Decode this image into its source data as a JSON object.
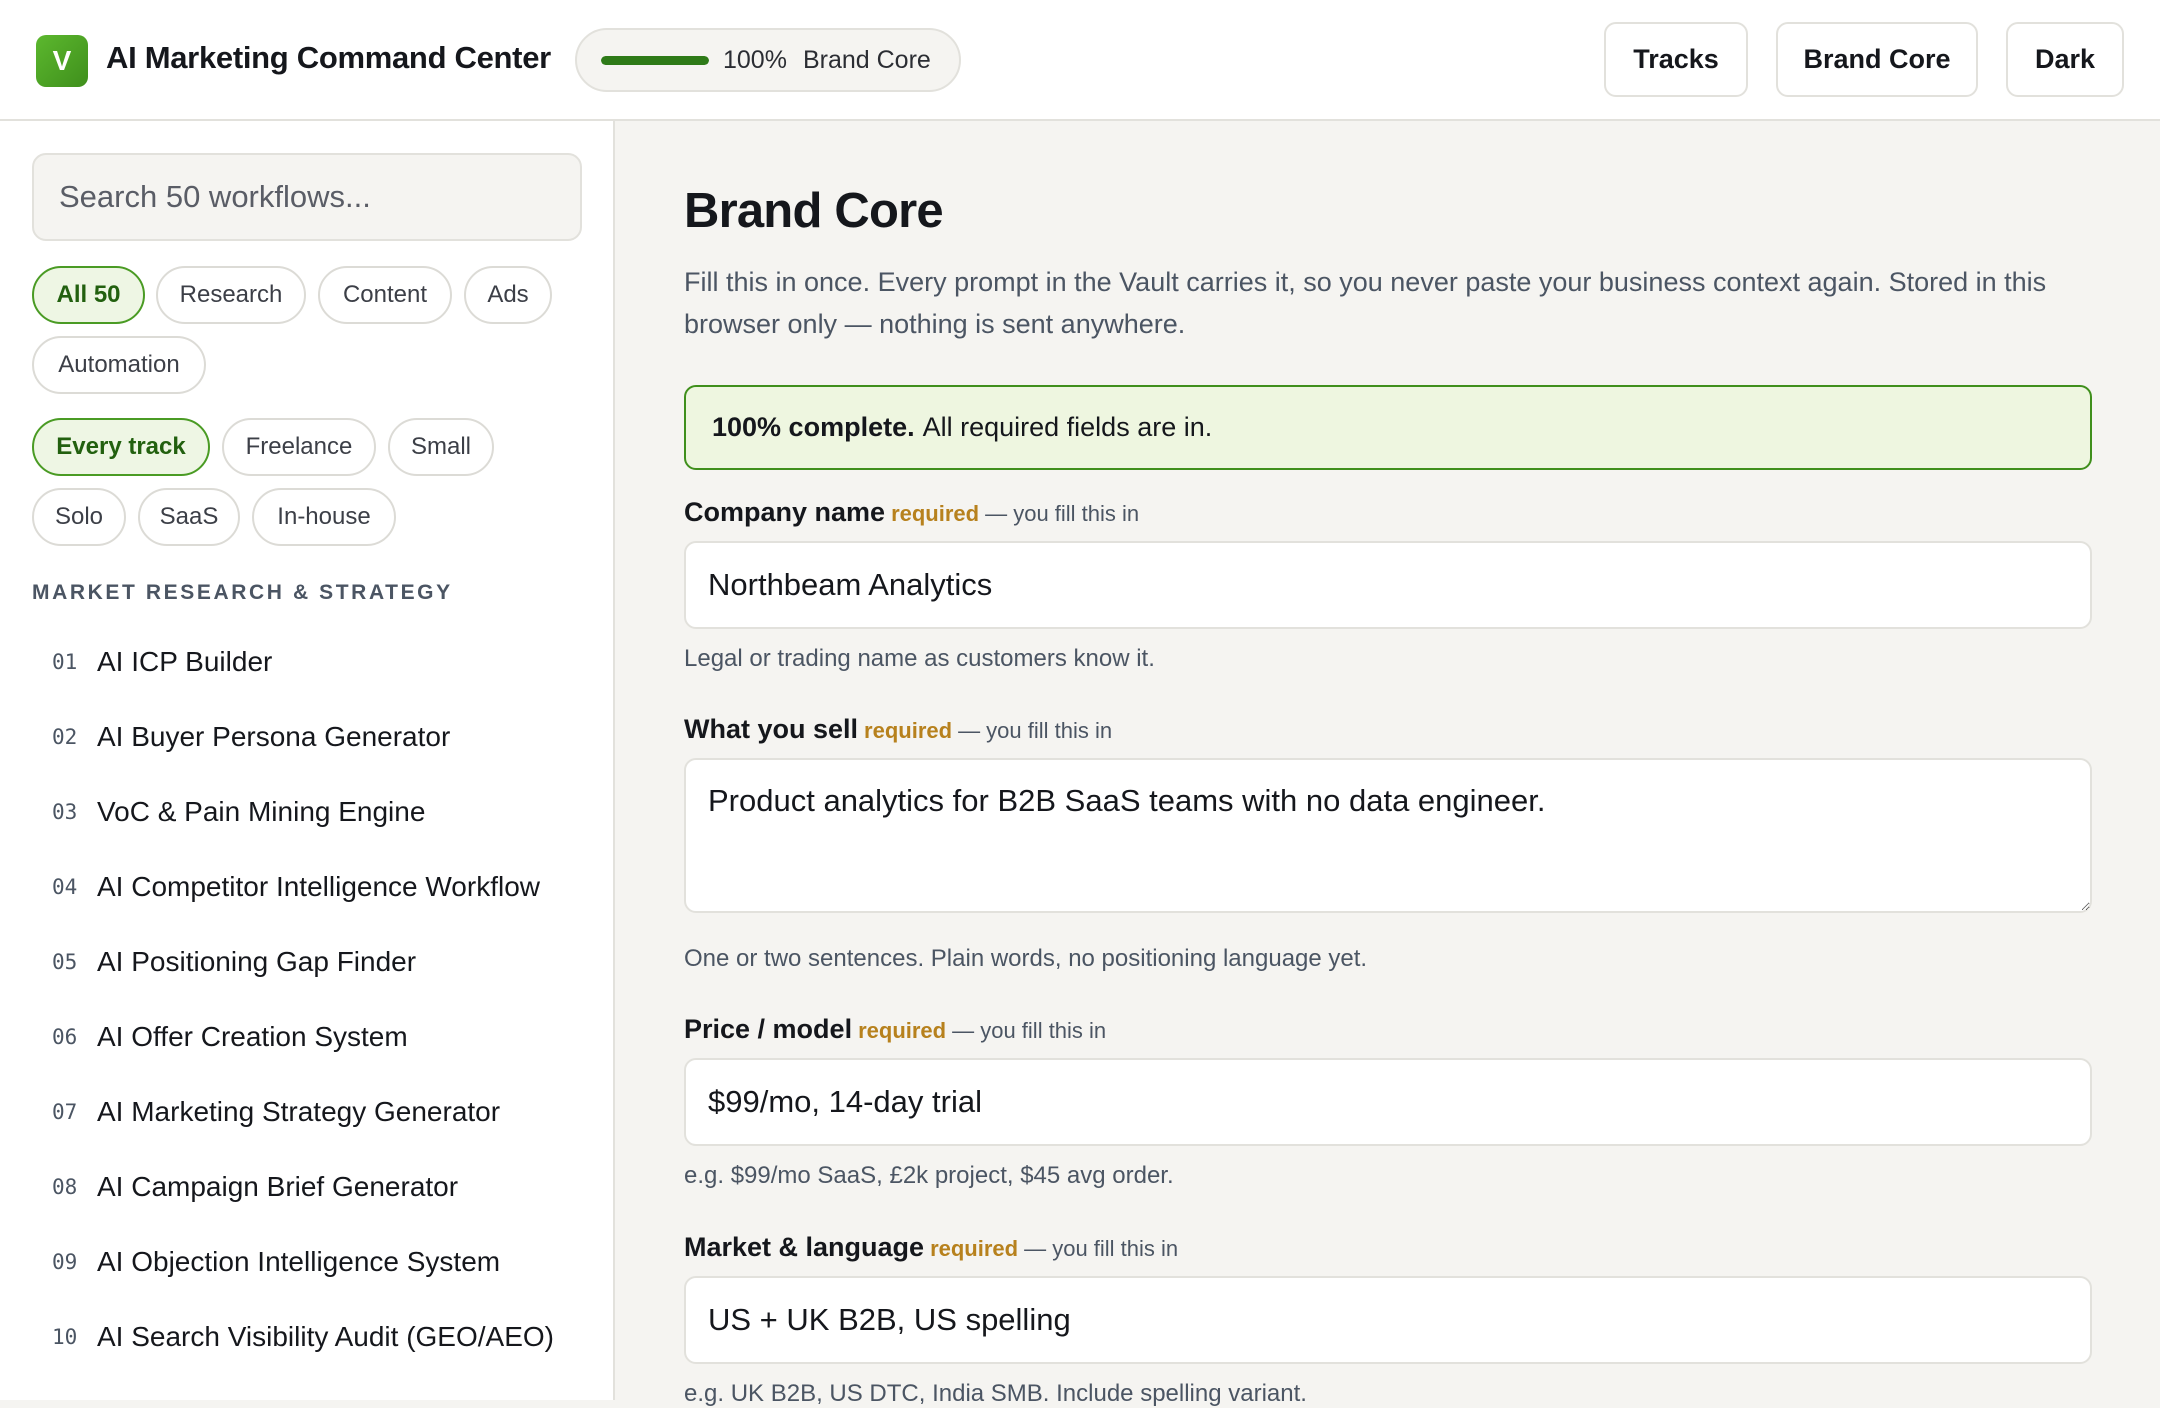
{
  "header": {
    "logo_letter": "V",
    "title": "AI Marketing Command Center",
    "progress": {
      "percent_label": "100%",
      "fraction": 1.0,
      "label": "Brand Core"
    },
    "buttons": {
      "tracks": "Tracks",
      "brand_core": "Brand Core",
      "dark": "Dark"
    }
  },
  "sidebar": {
    "search_placeholder": "Search 50 workflows...",
    "category_chips": [
      "All 50",
      "Research",
      "Content",
      "Ads",
      "Automation"
    ],
    "track_chips": [
      "Every track",
      "Freelance",
      "Small",
      "Solo",
      "SaaS",
      "In-house"
    ],
    "section_title": "MARKET RESEARCH & STRATEGY",
    "workflows": [
      {
        "num": "01",
        "name": "AI ICP Builder"
      },
      {
        "num": "02",
        "name": "AI Buyer Persona Generator"
      },
      {
        "num": "03",
        "name": "VoC & Pain Mining Engine"
      },
      {
        "num": "04",
        "name": "AI Competitor Intelligence Workflow"
      },
      {
        "num": "05",
        "name": "AI Positioning Gap Finder"
      },
      {
        "num": "06",
        "name": "AI Offer Creation System"
      },
      {
        "num": "07",
        "name": "AI Marketing Strategy Generator"
      },
      {
        "num": "08",
        "name": "AI Campaign Brief Generator"
      },
      {
        "num": "09",
        "name": "AI Objection Intelligence System"
      },
      {
        "num": "10",
        "name": "AI Search Visibility Audit (GEO/AEO)"
      }
    ]
  },
  "main": {
    "title": "Brand Core",
    "description": "Fill this in once. Every prompt in the Vault carries it, so you never paste your business context again. Stored in this browser only — nothing is sent anywhere.",
    "banner": {
      "bold": "100% complete.",
      "text": "All required fields are in."
    },
    "fields": [
      {
        "label": "Company name",
        "required": "required",
        "fill_note": "— you fill this in",
        "value": "Northbeam Analytics",
        "help": "Legal or trading name as customers know it."
      },
      {
        "label": "What you sell",
        "required": "required",
        "fill_note": "— you fill this in",
        "value": "Product analytics for B2B SaaS teams with no data engineer.",
        "help": "One or two sentences. Plain words, no positioning language yet."
      },
      {
        "label": "Price / model",
        "required": "required",
        "fill_note": "— you fill this in",
        "value": "$99/mo, 14-day trial",
        "help": "e.g. $99/mo SaaS, £2k project, $45 avg order."
      },
      {
        "label": "Market & language",
        "required": "required",
        "fill_note": "— you fill this in",
        "value": "US + UK B2B, US spelling",
        "help": "e.g. UK B2B, US DTC, India SMB. Include spelling variant."
      }
    ]
  }
}
